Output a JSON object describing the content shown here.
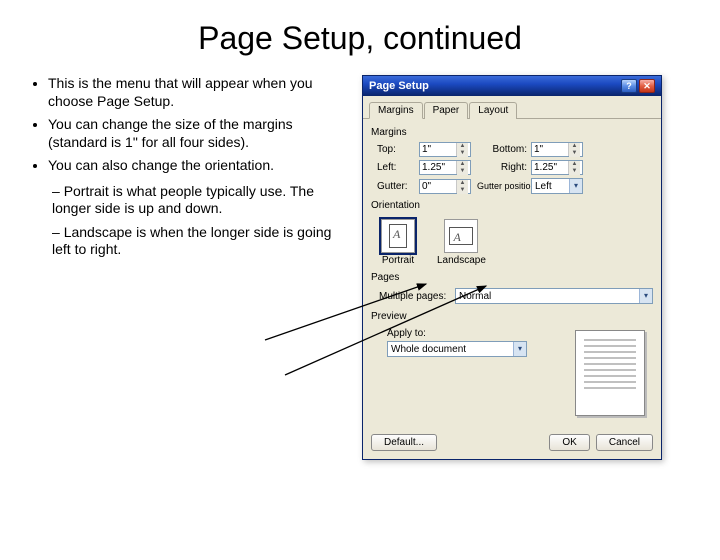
{
  "title": "Page Setup, continued",
  "bullets": [
    "This is the menu that will appear when you choose Page Setup.",
    "You can change the size of the margins (standard is 1\" for all four sides).",
    "You can also change the orientation."
  ],
  "subbullets": [
    "Portrait is what people typically use.  The longer side is up and down.",
    "Landscape is when the longer side is going left to right."
  ],
  "dialog": {
    "title": "Page Setup",
    "tabs": [
      "Margins",
      "Paper",
      "Layout"
    ],
    "activeTab": "Margins",
    "marginsSection": "Margins",
    "labels": {
      "top": "Top:",
      "bottom": "Bottom:",
      "left": "Left:",
      "right": "Right:",
      "gutter": "Gutter:",
      "gutterPos": "Gutter position:"
    },
    "values": {
      "top": "1\"",
      "bottom": "1\"",
      "left": "1.25\"",
      "right": "1.25\"",
      "gutter": "0\"",
      "gutterPos": "Left"
    },
    "orientationSection": "Orientation",
    "orientation": {
      "portrait": "Portrait",
      "landscape": "Landscape",
      "selected": "Portrait"
    },
    "pagesSection": "Pages",
    "multiplePagesLabel": "Multiple pages:",
    "multiplePagesValue": "Normal",
    "previewSection": "Preview",
    "applyToLabel": "Apply to:",
    "applyToValue": "Whole document",
    "buttons": {
      "default": "Default...",
      "ok": "OK",
      "cancel": "Cancel"
    }
  }
}
